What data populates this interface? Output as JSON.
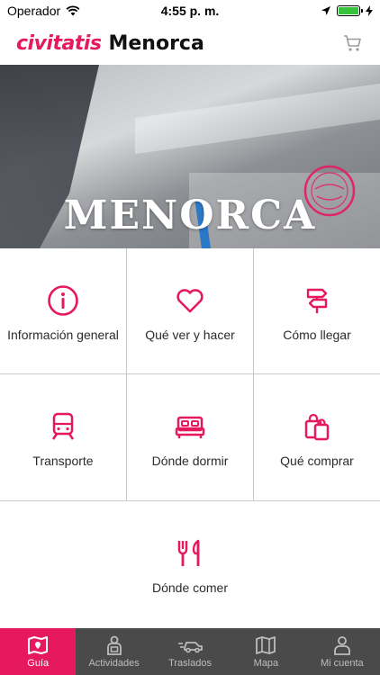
{
  "status_bar": {
    "carrier": "Operador",
    "time": "4:55 p. m."
  },
  "header": {
    "brand": "civitatis",
    "city": "Menorca"
  },
  "hero": {
    "title": "MENORCA"
  },
  "grid": [
    {
      "label": "Información general",
      "icon": "info-icon"
    },
    {
      "label": "Qué ver y hacer",
      "icon": "heart-icon"
    },
    {
      "label": "Cómo llegar",
      "icon": "signpost-icon"
    },
    {
      "label": "Transporte",
      "icon": "train-icon"
    },
    {
      "label": "Dónde dormir",
      "icon": "bed-icon"
    },
    {
      "label": "Qué comprar",
      "icon": "shopping-bags-icon"
    },
    {
      "label": "Dónde comer",
      "icon": "fork-knife-icon"
    }
  ],
  "tabbar": [
    {
      "label": "Guía",
      "icon": "map-book-icon",
      "active": true
    },
    {
      "label": "Actividades",
      "icon": "person-icon"
    },
    {
      "label": "Traslados",
      "icon": "car-icon"
    },
    {
      "label": "Mapa",
      "icon": "map-icon"
    },
    {
      "label": "Mi cuenta",
      "icon": "user-icon"
    }
  ],
  "colors": {
    "accent": "#e6195f",
    "tabbar_bg": "#4a4a4a",
    "battery": "#36c23a"
  }
}
